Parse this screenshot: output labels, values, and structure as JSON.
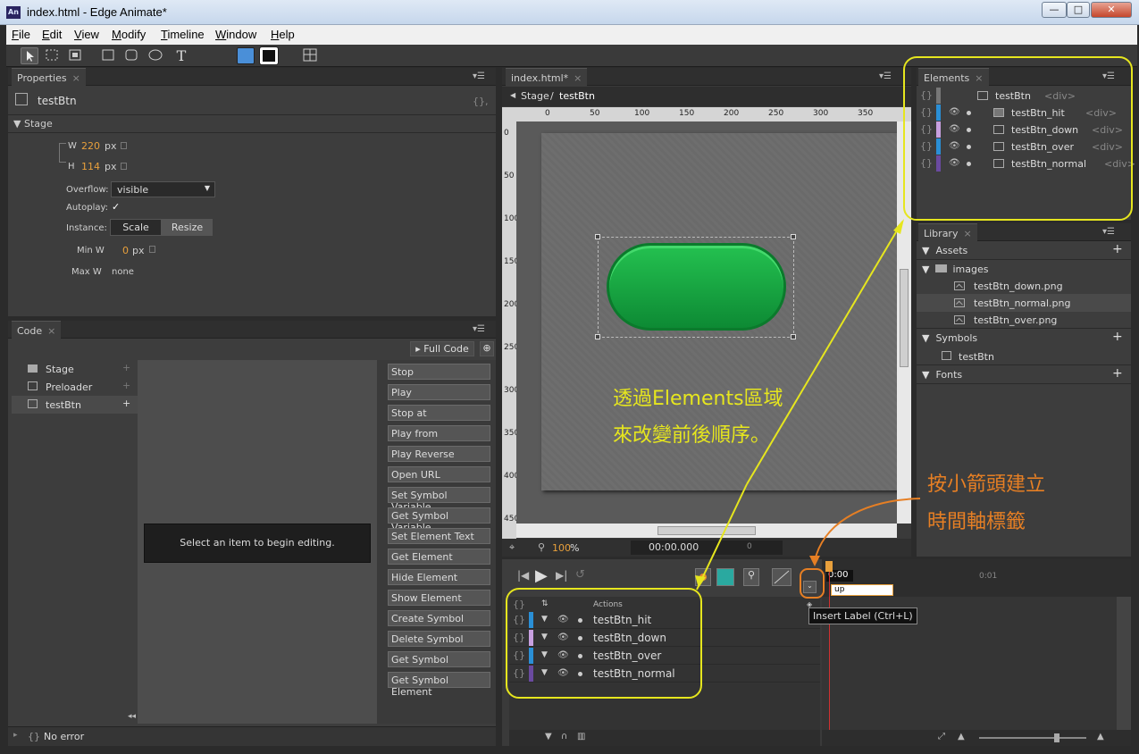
{
  "window": {
    "app_icon": "An",
    "title": "index.html - Edge Animate*",
    "controls": [
      "minimize-icon",
      "maximize-icon",
      "close-icon"
    ]
  },
  "menu": [
    "File",
    "Edit",
    "View",
    "Modify",
    "Timeline",
    "Window",
    "Help"
  ],
  "properties_panel": {
    "tab": "Properties",
    "symbol_name": "testBtn",
    "code_icon": "{},",
    "section": "Stage",
    "w_label": "W",
    "w_value": "220",
    "h_label": "H",
    "h_value": "114",
    "unit": "px",
    "overflow_label": "Overflow:",
    "overflow_value": "visible",
    "autoplay_label": "Autoplay:",
    "autoplay_checked": "✓",
    "instance_label": "Instance:",
    "scale_label": "Scale",
    "resize_label": "Resize",
    "minw_label": "Min W",
    "minw_value": "0",
    "maxw_label": "Max W",
    "maxw_value": "none"
  },
  "code_panel": {
    "tab": "Code",
    "full_code": "Full Code",
    "tree": [
      "Stage",
      "Preloader",
      "testBtn"
    ],
    "placeholder": "Select an item to begin editing.",
    "snippets": [
      "Stop",
      "Play",
      "Stop at",
      "Play from",
      "Play Reverse",
      "Open URL",
      "Set Symbol Variable",
      "Get Symbol Variable",
      "Set Element Text",
      "Get Element",
      "Hide Element",
      "Show Element",
      "Create Symbol",
      "Delete Symbol",
      "Get Symbol",
      "Get Symbol Element"
    ],
    "status": "No error",
    "status_braces": "{}"
  },
  "stage_panel": {
    "tab": "index.html*",
    "breadcrumb_root": "Stage",
    "breadcrumb_sep": "/",
    "breadcrumb_current": "testBtn",
    "ruler_h": [
      "0",
      "50",
      "100",
      "150",
      "200",
      "250",
      "300",
      "350"
    ],
    "ruler_v": [
      "0",
      "50",
      "100",
      "150",
      "200",
      "250",
      "300",
      "350",
      "400",
      "450"
    ],
    "zoom": "100",
    "zoom_unit": "%",
    "time": "00:00.000",
    "frame": "0"
  },
  "elements_panel": {
    "tab": "Elements",
    "items": [
      {
        "name": "testBtn",
        "tag": "<div>",
        "color": "#777777"
      },
      {
        "name": "testBtn_hit",
        "tag": "<div>",
        "color": "#2a8fd6"
      },
      {
        "name": "testBtn_down",
        "tag": "<div>",
        "color": "#c8a0e0"
      },
      {
        "name": "testBtn_over",
        "tag": "<div>",
        "color": "#2a8fd6"
      },
      {
        "name": "testBtn_normal",
        "tag": "<div>",
        "color": "#6a4aa0"
      }
    ]
  },
  "library_panel": {
    "tab": "Library",
    "assets": "Assets",
    "images_folder": "images",
    "images": [
      "testBtn_down.png",
      "testBtn_normal.png",
      "testBtn_over.png"
    ],
    "symbols": "Symbols",
    "symbol_items": [
      "testBtn"
    ],
    "fonts": "Fonts"
  },
  "timeline": {
    "current_time": "0:00",
    "marker_time": "0:01",
    "label_input": "up",
    "tooltip": "Insert Label (Ctrl+L)",
    "actions_header": "Actions",
    "layers": [
      {
        "name": "testBtn_hit",
        "color": "#2a8fd6"
      },
      {
        "name": "testBtn_down",
        "color": "#c8a0e0"
      },
      {
        "name": "testBtn_over",
        "color": "#2a8fd6"
      },
      {
        "name": "testBtn_normal",
        "color": "#6a4aa0"
      }
    ]
  },
  "annotations": {
    "elements_line1": "透過Elements區域",
    "elements_line2": "來改變前後順序。",
    "label_line1": "按小箭頭建立",
    "label_line2": "時間軸標籤"
  }
}
